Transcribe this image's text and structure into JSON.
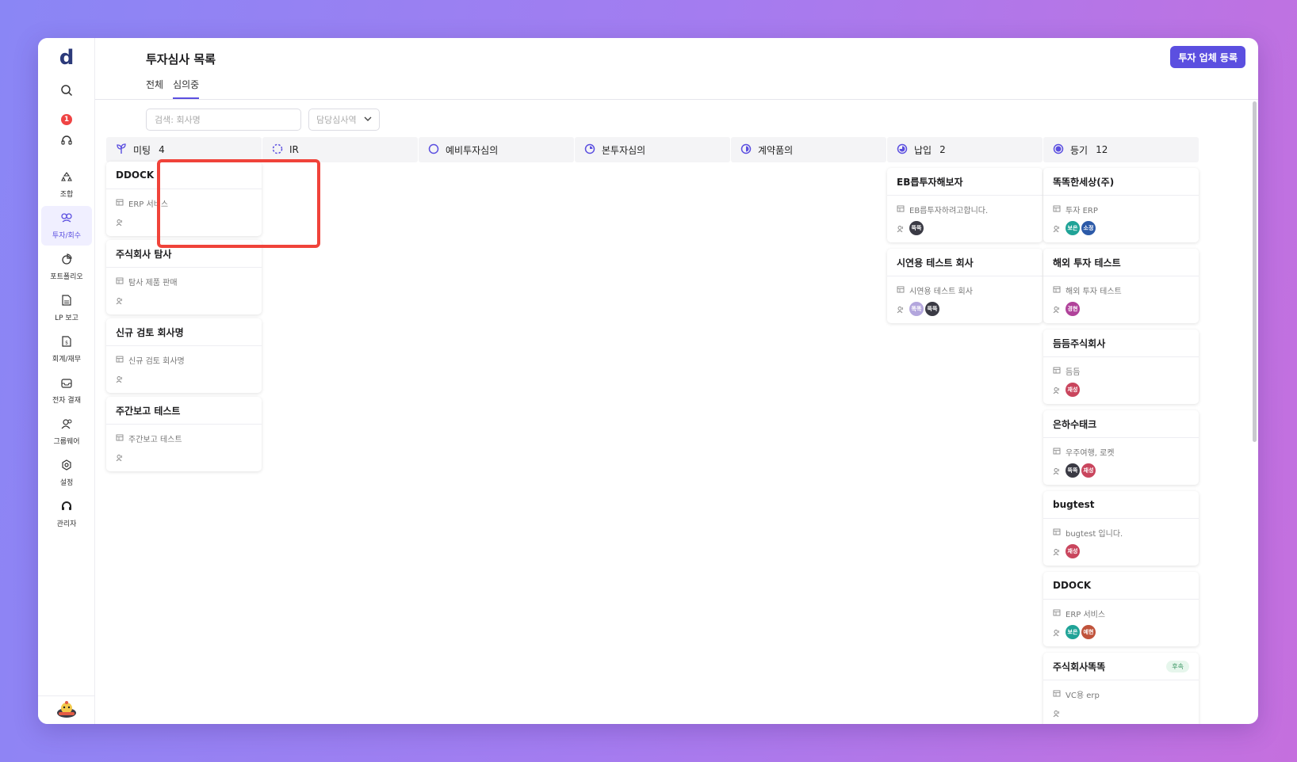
{
  "app": {
    "logo": "d",
    "notification_count": "1"
  },
  "sidebar": {
    "items": [
      {
        "label": "조합",
        "icon": "recycle-icon",
        "active": false
      },
      {
        "label": "투자/회수",
        "icon": "link-icon",
        "active": true
      },
      {
        "label": "포트폴리오",
        "icon": "pie-chart-icon",
        "active": false
      },
      {
        "label": "LP 보고",
        "icon": "document-icon",
        "active": false
      },
      {
        "label": "회계/재무",
        "icon": "finance-doc-icon",
        "active": false
      },
      {
        "label": "전자 결재",
        "icon": "inbox-icon",
        "active": false
      },
      {
        "label": "그룹웨어",
        "icon": "users-icon",
        "active": false
      },
      {
        "label": "설정",
        "icon": "gear-icon",
        "active": false
      },
      {
        "label": "관리자",
        "icon": "headset-admin-icon",
        "active": false
      }
    ]
  },
  "header": {
    "title": "투자심사 목록",
    "tabs": [
      {
        "label": "전체",
        "active": false
      },
      {
        "label": "심의중",
        "active": true
      }
    ],
    "register_button": "투자 업체 등록"
  },
  "filters": {
    "search_placeholder": "검색: 회사명",
    "reviewer_select": "담당심사역"
  },
  "columns": [
    {
      "title": "미팅",
      "count": "4",
      "icon": "sprout-icon",
      "cards": [
        {
          "name": "DDOCK",
          "desc": "ERP 서비스",
          "avatars": []
        },
        {
          "name": "주식회사 탐사",
          "desc": "탐사 제품 판매",
          "avatars": []
        },
        {
          "name": "신규 검토 회사명",
          "desc": "신규 검토 회사명",
          "avatars": []
        },
        {
          "name": "주간보고 테스트",
          "desc": "주간보고 테스트",
          "avatars": []
        }
      ]
    },
    {
      "title": "IR",
      "count": "",
      "icon": "dashed-circle-icon",
      "cards": []
    },
    {
      "title": "예비투자심의",
      "count": "",
      "icon": "empty-circle-icon",
      "cards": []
    },
    {
      "title": "본투자심의",
      "count": "",
      "icon": "quarter-circle-icon",
      "cards": []
    },
    {
      "title": "계약품의",
      "count": "",
      "icon": "half-circle-icon",
      "cards": []
    },
    {
      "title": "납입",
      "count": "2",
      "icon": "three-quarter-circle-icon",
      "cards": [
        {
          "name": "EB릅투자해보자",
          "desc": "EB릅투자하려고합니다.",
          "avatars": [
            {
              "t": "뚝뚝",
              "c": "#3a3a44"
            }
          ]
        },
        {
          "name": "시연용 테스트 회사",
          "desc": "시연용 테스트 회사",
          "avatars": [
            {
              "t": "똑똑",
              "c": "#b3a6dd"
            },
            {
              "t": "뚝뚝",
              "c": "#3a3a44"
            }
          ]
        }
      ]
    },
    {
      "title": "등기",
      "count": "12",
      "icon": "filled-circle-icon",
      "cards": [
        {
          "name": "똑똑한세상(주)",
          "desc": "투자 ERP",
          "avatars": [
            {
              "t": "보은",
              "c": "#1fa397"
            },
            {
              "t": "소정",
              "c": "#2c5aa8"
            }
          ]
        },
        {
          "name": "해외 투자 테스트",
          "desc": "해외 투자 테스트",
          "avatars": [
            {
              "t": "경현",
              "c": "#b0429a"
            }
          ]
        },
        {
          "name": "듬듬주식회사",
          "desc": "듬듬",
          "avatars": [
            {
              "t": "재성",
              "c": "#c9455d"
            }
          ]
        },
        {
          "name": "은하수태크",
          "desc": "우주여행, 로켓",
          "avatars": [
            {
              "t": "뚝뚝",
              "c": "#3a3a44"
            },
            {
              "t": "재성",
              "c": "#c9455d"
            }
          ]
        },
        {
          "name": "bugtest",
          "desc": "bugtest 입니다.",
          "avatars": [
            {
              "t": "재성",
              "c": "#c9455d"
            }
          ]
        },
        {
          "name": "DDOCK",
          "desc": "ERP 서비스",
          "avatars": [
            {
              "t": "보은",
              "c": "#1fa397"
            },
            {
              "t": "예현",
              "c": "#c0533b"
            }
          ]
        },
        {
          "name": "주식회사똑똑",
          "desc": "VC용 erp",
          "badge": "후속",
          "avatars": []
        }
      ]
    }
  ]
}
